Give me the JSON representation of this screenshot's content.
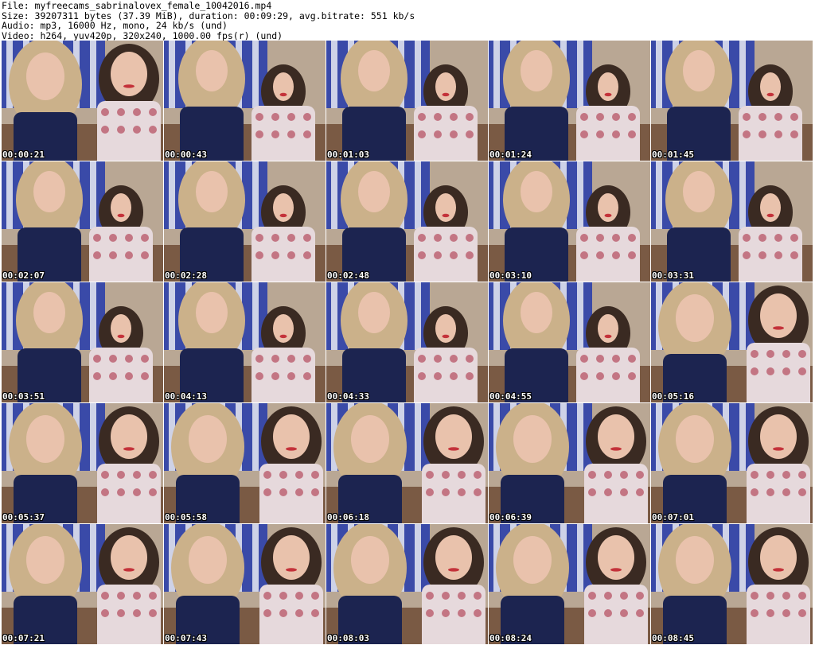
{
  "header": {
    "lines": [
      "File: myfreecams_sabrinalovex_female_10042016.mp4",
      "Size: 39207311 bytes (37.39 MiB), duration: 00:09:29, avg.bitrate: 551 kb/s",
      "Audio: mp3, 16000 Hz, mono, 24 kb/s (und)",
      "Video: h264, yuv420p, 320x240, 1000.00 fps(r) (und)"
    ]
  },
  "thumbnails": [
    {
      "timestamp": "00:00:21",
      "scene": "closeup"
    },
    {
      "timestamp": "00:00:43",
      "scene": "wide"
    },
    {
      "timestamp": "00:01:03",
      "scene": "wide"
    },
    {
      "timestamp": "00:01:24",
      "scene": "wide"
    },
    {
      "timestamp": "00:01:45",
      "scene": "wide"
    },
    {
      "timestamp": "00:02:07",
      "scene": "wide"
    },
    {
      "timestamp": "00:02:28",
      "scene": "wide"
    },
    {
      "timestamp": "00:02:48",
      "scene": "wide"
    },
    {
      "timestamp": "00:03:10",
      "scene": "wide"
    },
    {
      "timestamp": "00:03:31",
      "scene": "wide"
    },
    {
      "timestamp": "00:03:51",
      "scene": "wide"
    },
    {
      "timestamp": "00:04:13",
      "scene": "wide"
    },
    {
      "timestamp": "00:04:33",
      "scene": "wide"
    },
    {
      "timestamp": "00:04:55",
      "scene": "wide"
    },
    {
      "timestamp": "00:05:16",
      "scene": "closeup"
    },
    {
      "timestamp": "00:05:37",
      "scene": "closeup"
    },
    {
      "timestamp": "00:05:58",
      "scene": "closeup"
    },
    {
      "timestamp": "00:06:18",
      "scene": "closeup"
    },
    {
      "timestamp": "00:06:39",
      "scene": "closeup"
    },
    {
      "timestamp": "00:07:01",
      "scene": "closeup"
    },
    {
      "timestamp": "00:07:21",
      "scene": "closeup"
    },
    {
      "timestamp": "00:07:43",
      "scene": "closeup"
    },
    {
      "timestamp": "00:08:03",
      "scene": "closeup"
    },
    {
      "timestamp": "00:08:24",
      "scene": "closeup"
    },
    {
      "timestamp": "00:08:45",
      "scene": "closeup"
    }
  ],
  "colors": {
    "wall": "#b9a794",
    "curtain_blue": "#3a4aa8",
    "curtain_light": "#e9eaf2",
    "couch": "#7a5a44",
    "blonde_hair": "#cbb18a",
    "brunette_hair": "#3a2a22",
    "skin": "#e9c2ac",
    "navy_dress": "#1c2450",
    "floral_top": "#e6d9dc",
    "floral_accent": "#b34a5c"
  }
}
